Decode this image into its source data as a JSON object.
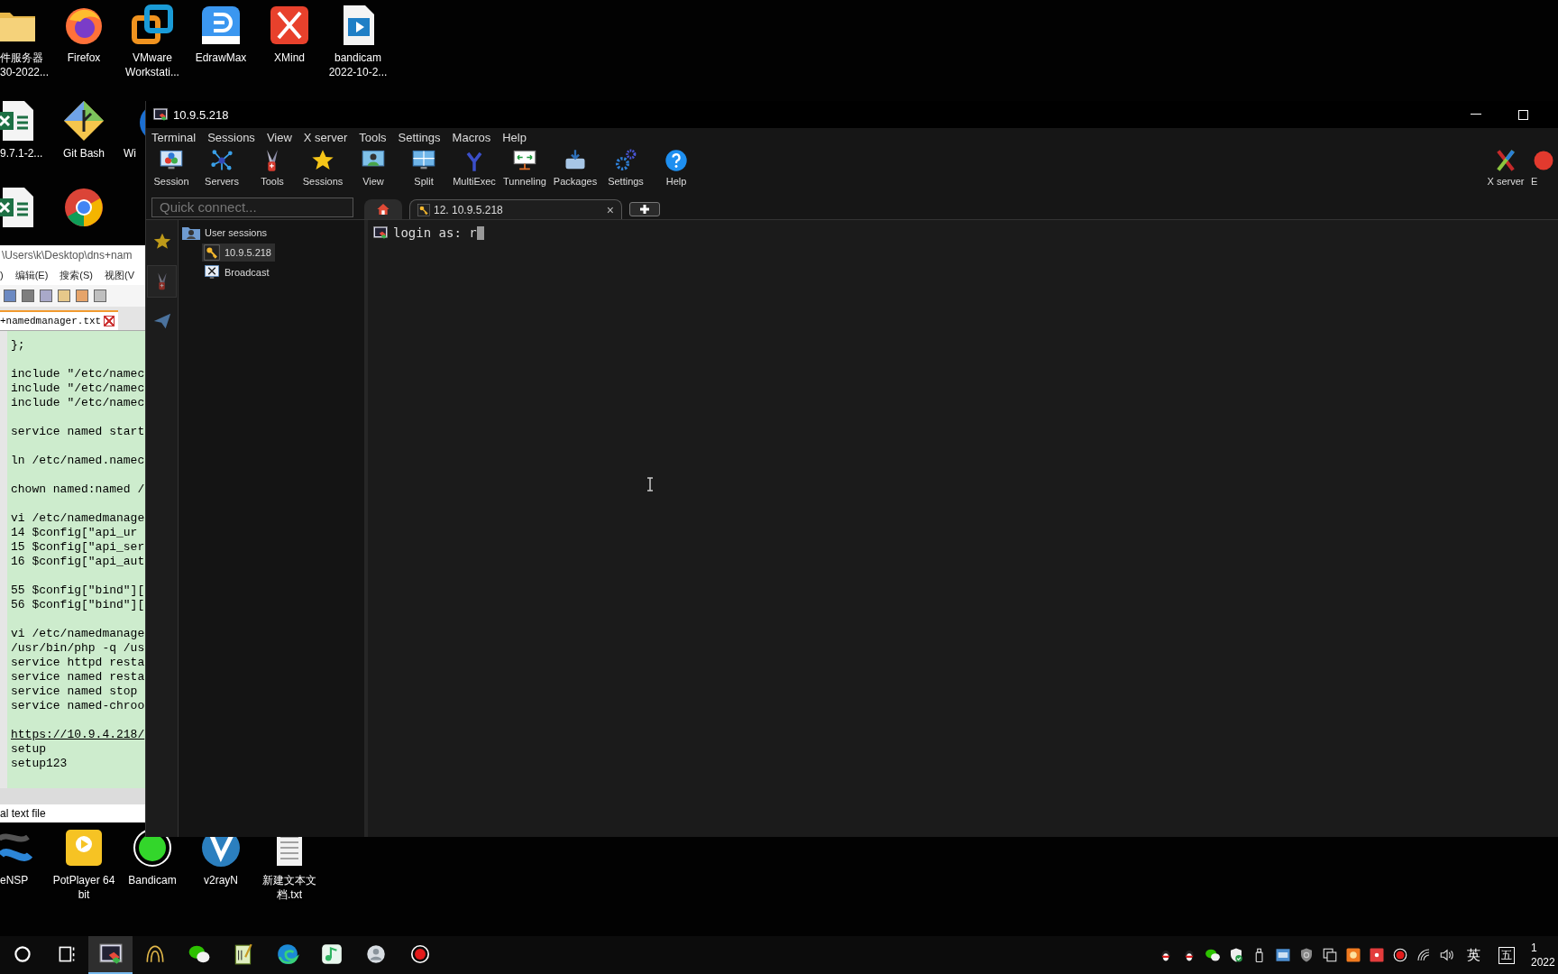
{
  "desktop_icons": [
    {
      "kind": "folder",
      "lines": [
        "件服务器",
        "30-2022..."
      ]
    },
    {
      "kind": "firefox",
      "lines": [
        "Firefox"
      ]
    },
    {
      "kind": "vmware",
      "lines": [
        "VMware",
        "Workstati..."
      ]
    },
    {
      "kind": "edraw",
      "lines": [
        "EdrawMax"
      ]
    },
    {
      "kind": "xmind",
      "lines": [
        "XMind"
      ]
    },
    {
      "kind": "video-file",
      "lines": [
        "bandicam",
        "2022-10-2..."
      ]
    },
    {
      "kind": "excel",
      "lines": [
        "9.7.1-2..."
      ]
    },
    {
      "kind": "gitbash",
      "lines": [
        "Git Bash"
      ]
    },
    {
      "kind": "generic",
      "lines": [
        "Wi"
      ]
    },
    {
      "kind": "excel"
    },
    {
      "kind": "chrome"
    },
    {
      "kind": "ensp",
      "lines": [
        "eNSP"
      ]
    },
    {
      "kind": "potplayer",
      "lines": [
        "PotPlayer 64",
        "bit"
      ]
    },
    {
      "kind": "bandicam",
      "lines": [
        "Bandicam"
      ]
    },
    {
      "kind": "v2ray",
      "lines": [
        "v2rayN"
      ]
    },
    {
      "kind": "text-file",
      "lines": [
        "新建文本文",
        "档.txt"
      ]
    }
  ],
  "editor_window": {
    "title": "\\Users\\k\\Desktop\\dns+nam",
    "menu": [
      ")",
      "编辑(E)",
      "搜索(S)",
      "视图(V"
    ],
    "tab": "+namedmanager.txt",
    "blocks": [
      {
        "lines": [
          "};"
        ]
      },
      {
        "lines": [
          "include \"/etc/namec",
          "include \"/etc/namec",
          "include \"/etc/namec"
        ]
      },
      {
        "lines": [
          "service named start"
        ]
      },
      {
        "lines": [
          "ln /etc/named.namec"
        ]
      },
      {
        "lines": [
          "chown named:named /"
        ]
      },
      {
        "lines": [
          "vi /etc/namedmanage",
          "14 $config[\"api_ur",
          "15 $config[\"api_ser",
          "16 $config[\"api_aut"
        ]
      },
      {
        "lines": [
          "55 $config[\"bind\"][",
          "56 $config[\"bind\"]["
        ]
      },
      {
        "lines": [
          "vi /etc/namedmanage",
          "/usr/bin/php -q /us",
          "service httpd resta",
          "service named resta",
          "service named stop",
          "service named-chroo"
        ]
      },
      {
        "link": "https://10.9.4.218/",
        "lines": [
          "setup",
          "setup123"
        ]
      }
    ],
    "status": "al text file"
  },
  "terminal_window": {
    "title": "10.9.5.218",
    "menu": [
      "Terminal",
      "Sessions",
      "View",
      "X server",
      "Tools",
      "Settings",
      "Macros",
      "Help"
    ],
    "toolbar": [
      {
        "kind": "session",
        "label": "Session"
      },
      {
        "kind": "servers",
        "label": "Servers"
      },
      {
        "kind": "tools",
        "label": "Tools"
      },
      {
        "kind": "sessions",
        "label": "Sessions"
      },
      {
        "kind": "view",
        "label": "View"
      },
      {
        "kind": "split",
        "label": "Split"
      },
      {
        "kind": "multiexec",
        "label": "MultiExec"
      },
      {
        "kind": "tunneling",
        "label": "Tunneling"
      },
      {
        "kind": "packages",
        "label": "Packages"
      },
      {
        "kind": "settings",
        "label": "Settings"
      },
      {
        "kind": "help",
        "label": "Help"
      }
    ],
    "toolbar_right": [
      {
        "kind": "xserver",
        "label": "X server"
      },
      {
        "kind": "exit",
        "label": "E"
      }
    ],
    "quick_connect": {
      "placeholder": "Quick connect..."
    },
    "tabs": [
      {
        "kind": "home",
        "selected": false
      },
      {
        "kind": "session",
        "label": "12. 10.9.5.218",
        "close": "×",
        "selected": true
      },
      {
        "kind": "new"
      }
    ],
    "side_tabs": [
      {
        "kind": "star",
        "selected": false
      },
      {
        "kind": "tools",
        "selected": true
      },
      {
        "kind": "send",
        "selected": false
      }
    ],
    "session_tree": {
      "label": "User sessions",
      "children": [
        {
          "kind": "ssh",
          "label": "10.9.5.218",
          "selected": true
        },
        {
          "kind": "x",
          "label": "Broadcast",
          "selected": false
        }
      ]
    },
    "terminal": {
      "prompt": "login as: ",
      "typed": "r"
    }
  },
  "taskbar": {
    "apps": [
      {
        "kind": "search",
        "active": false
      },
      {
        "kind": "taskview",
        "active": false
      },
      {
        "kind": "moba",
        "active": true
      },
      {
        "kind": "mate",
        "active": false
      },
      {
        "kind": "wechat",
        "active": false
      },
      {
        "kind": "notepadpp",
        "active": false
      },
      {
        "kind": "edge",
        "active": false
      },
      {
        "kind": "qqmusic",
        "active": false
      },
      {
        "kind": "avatar",
        "active": false
      },
      {
        "kind": "recorder",
        "active": false
      }
    ],
    "tray": [
      {
        "kind": "qq"
      },
      {
        "kind": "qq"
      },
      {
        "kind": "wechat"
      },
      {
        "kind": "defender"
      },
      {
        "kind": "usb"
      },
      {
        "kind": "hdx"
      },
      {
        "kind": "shield"
      },
      {
        "kind": "copy"
      },
      {
        "kind": "orange"
      },
      {
        "kind": "red"
      },
      {
        "kind": "record"
      },
      {
        "kind": "wifi"
      },
      {
        "kind": "speaker"
      }
    ],
    "ime": "英",
    "ime_mode": "五",
    "clock": [
      "1",
      "2022"
    ]
  }
}
